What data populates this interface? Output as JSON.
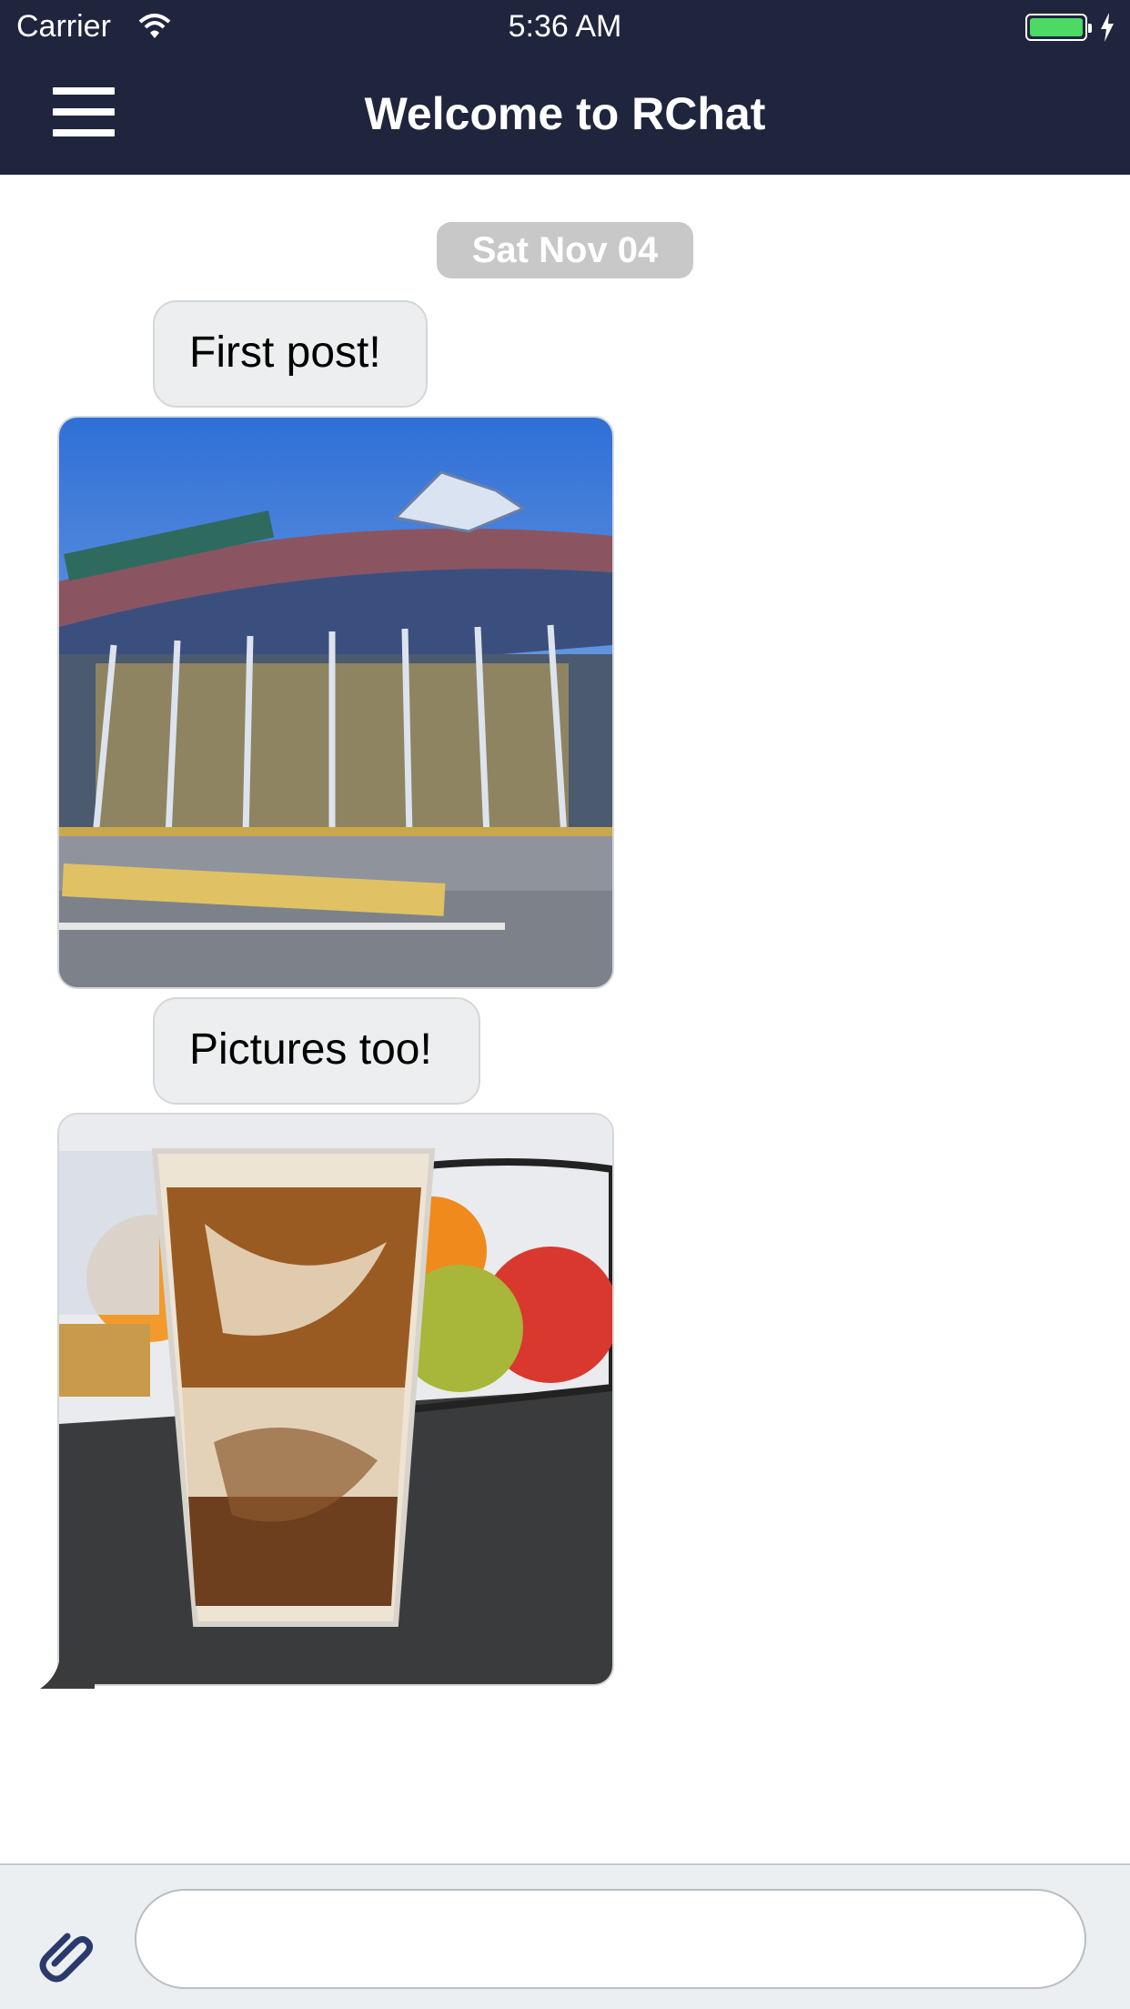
{
  "status_bar": {
    "carrier": "Carrier",
    "time": "5:36 AM"
  },
  "header": {
    "title": "Welcome to RChat"
  },
  "chat": {
    "date_label": "Sat Nov 04",
    "messages": [
      {
        "text": "First post!"
      },
      {
        "text": "Pictures too!"
      }
    ]
  },
  "composer": {
    "value": "",
    "placeholder": ""
  },
  "colors": {
    "header_bg": "#1f253d",
    "bubble_bg": "#eceeef",
    "date_pill_bg": "#c8c8c8",
    "input_bar_bg": "#eceff1",
    "attach_icon": "#2b3a6b"
  },
  "icons": [
    "menu-icon",
    "wifi-icon",
    "battery-icon",
    "charging-bolt-icon",
    "attach-icon"
  ]
}
